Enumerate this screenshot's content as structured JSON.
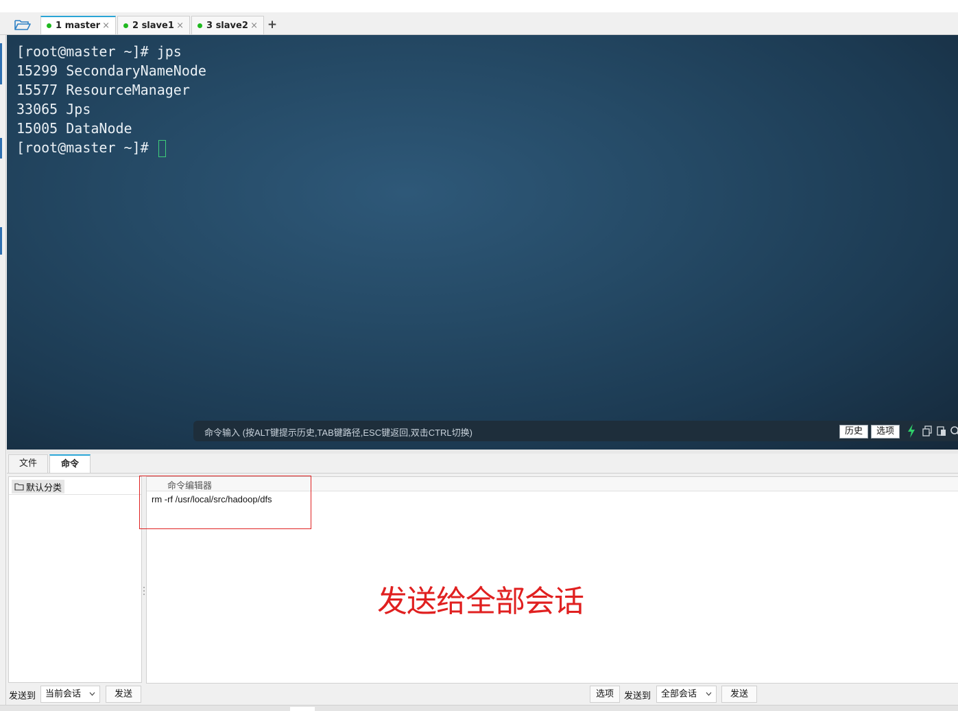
{
  "tabs": [
    {
      "label": "1 master",
      "active": true
    },
    {
      "label": "2 slave1",
      "active": false
    },
    {
      "label": "3 slave2",
      "active": false
    }
  ],
  "tab_close_glyph": "×",
  "add_tab_glyph": "+",
  "terminal": {
    "lines": [
      "[root@master ~]# jps",
      "15299 SecondaryNameNode",
      "15577 ResourceManager",
      "33065 Jps",
      "15005 DataNode"
    ],
    "prompt": "[root@master ~]# ",
    "cmd_hint": "命令输入 (按ALT键提示历史,TAB键路径,ESC键返回,双击CTRL切换)",
    "history_label": "历史",
    "options_label": "选项"
  },
  "bottom_tabs": [
    {
      "label": "文件",
      "active": false
    },
    {
      "label": "命令",
      "active": true
    }
  ],
  "category": {
    "label": "默认分类"
  },
  "editor": {
    "title": "命令编辑器",
    "command": "rm -rf /usr/local/src/hadoop/dfs"
  },
  "annotation": "发送给全部会话",
  "toolbar": {
    "send_to_label": "发送到",
    "left_target": "当前会话",
    "send_label": "发送",
    "options_label": "选项",
    "right_send_to_label": "发送到",
    "right_target": "全部会话",
    "right_send_label": "发送"
  },
  "colors": {
    "accent": "#2aa5d6",
    "status_dot": "#1fb81f",
    "annotation": "#e02020",
    "terminal_bg": "#1f3f58"
  },
  "icons": [
    "folder-open-icon",
    "add-tab-icon",
    "lightning-icon",
    "copy-icon",
    "paste-icon",
    "search-icon",
    "folder-icon",
    "chevron-down-icon"
  ]
}
